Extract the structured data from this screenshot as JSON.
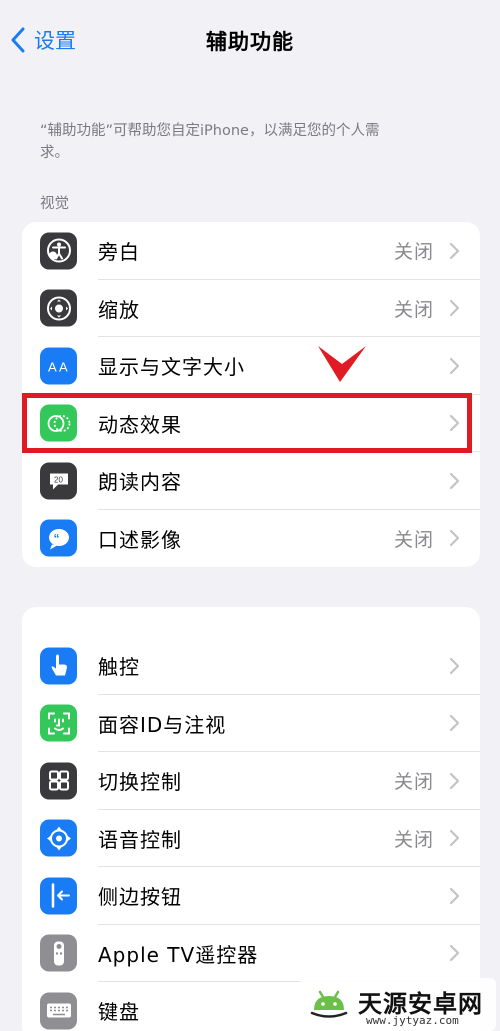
{
  "nav": {
    "back_label": "设置",
    "title": "辅助功能"
  },
  "description": "“辅助功能”可帮助您自定iPhone，以满足您的个人需求。",
  "section_vision": "视觉",
  "vision_items": [
    {
      "label": "旁白",
      "value": "关闭",
      "icon": "voiceover-icon",
      "color": "#3a3a3c"
    },
    {
      "label": "缩放",
      "value": "关闭",
      "icon": "zoom-icon",
      "color": "#3a3a3c"
    },
    {
      "label": "显示与文字大小",
      "value": "",
      "icon": "text-size-icon",
      "color": "#1a7cf5"
    },
    {
      "label": "动态效果",
      "value": "",
      "icon": "motion-icon",
      "color": "#34c759"
    },
    {
      "label": "朗读内容",
      "value": "",
      "icon": "spoken-content-icon",
      "color": "#3a3a3c"
    },
    {
      "label": "口述影像",
      "value": "关闭",
      "icon": "audio-description-icon",
      "color": "#1a7cf5"
    }
  ],
  "interaction_items": [
    {
      "label": "触控",
      "value": "",
      "icon": "touch-icon",
      "color": "#1a7cf5"
    },
    {
      "label": "面容ID与注视",
      "value": "",
      "icon": "face-id-icon",
      "color": "#34c759"
    },
    {
      "label": "切换控制",
      "value": "关闭",
      "icon": "switch-control-icon",
      "color": "#3a3a3c"
    },
    {
      "label": "语音控制",
      "value": "关闭",
      "icon": "voice-control-icon",
      "color": "#1a7cf5"
    },
    {
      "label": "侧边按钮",
      "value": "",
      "icon": "side-button-icon",
      "color": "#1a7cf5"
    },
    {
      "label": "Apple TV遥控器",
      "value": "",
      "icon": "apple-tv-remote-icon",
      "color": "#8e8e93"
    },
    {
      "label": "键盘",
      "value": "",
      "icon": "keyboard-icon",
      "color": "#8e8e93"
    }
  ],
  "highlight_color": "#e11b24",
  "accent_color": "#1a7cf5",
  "watermark": {
    "name": "天源安卓网",
    "url": "www.jytyaz.com"
  }
}
